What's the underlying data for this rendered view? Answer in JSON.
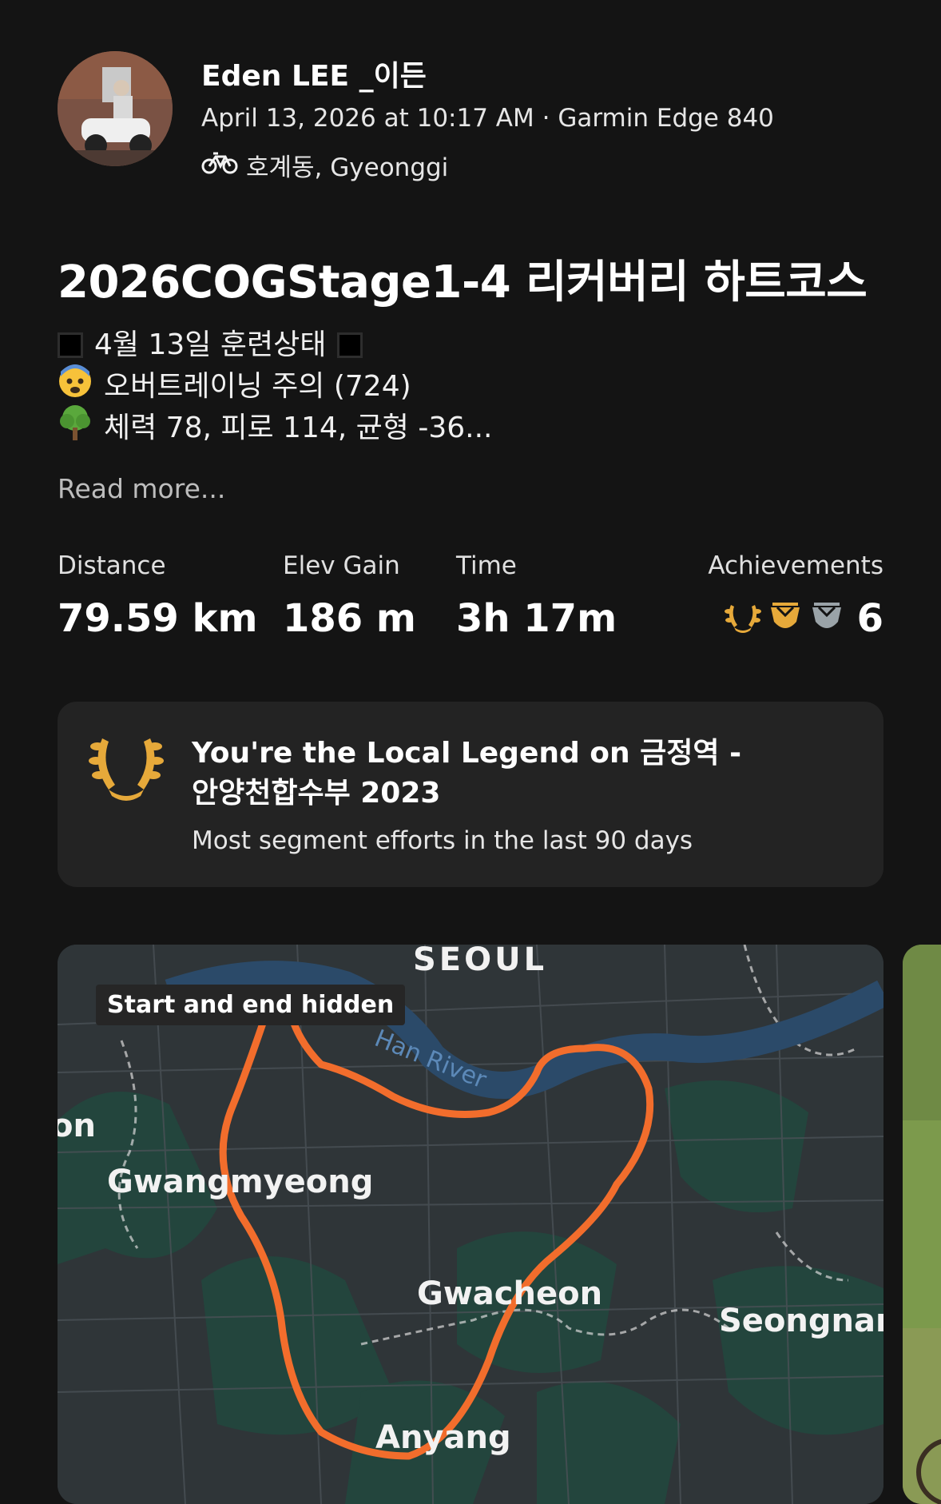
{
  "header": {
    "name": "Eden LEE _이든",
    "meta": "April 13, 2026 at 10:17 AM · Garmin Edge 840",
    "location": "호계동, Gyeonggi",
    "activity_icon": "bike-icon"
  },
  "activity": {
    "title": "2026COGStage1-4 리커버리 하트코스",
    "description": [
      {
        "prefix": "■",
        "text": "4월 13일 훈련상태",
        "suffix": "■"
      },
      {
        "prefix": "😨",
        "text": "오버트레이닝 주의 (724)"
      },
      {
        "prefix": "🌳",
        "text": "체력 78, 피로 114, 균형 -36..."
      }
    ],
    "read_more": "Read more..."
  },
  "stats": {
    "distance": {
      "label": "Distance",
      "value": "79.59 km"
    },
    "elev_gain": {
      "label": "Elev Gain",
      "value": "186 m"
    },
    "time": {
      "label": "Time",
      "value": "3h 17m"
    },
    "achievements": {
      "label": "Achievements",
      "value": "6",
      "icons": [
        "laurel-icon",
        "gold-trophy-icon",
        "silver-trophy-icon"
      ]
    }
  },
  "legend_card": {
    "title_line1": "You're the Local Legend on 금정역 -",
    "title_line2": "안양천합수부 2023",
    "subtitle": "Most segment efforts in the last 90 days",
    "icon": "laurel-icon"
  },
  "map": {
    "badge": "Start and end hidden",
    "labels": {
      "seoul": "SEOUL",
      "han_river": "Han River",
      "on": "on",
      "gwangmyeong": "Gwangmyeong",
      "gwacheon": "Gwacheon",
      "seongnam": "Seongnar",
      "anyang": "Anyang"
    },
    "route_color": "#f26d2c"
  },
  "colors": {
    "background": "#141414",
    "card": "#232323",
    "gold": "#e6a93a",
    "silver": "#9aa3a8"
  }
}
